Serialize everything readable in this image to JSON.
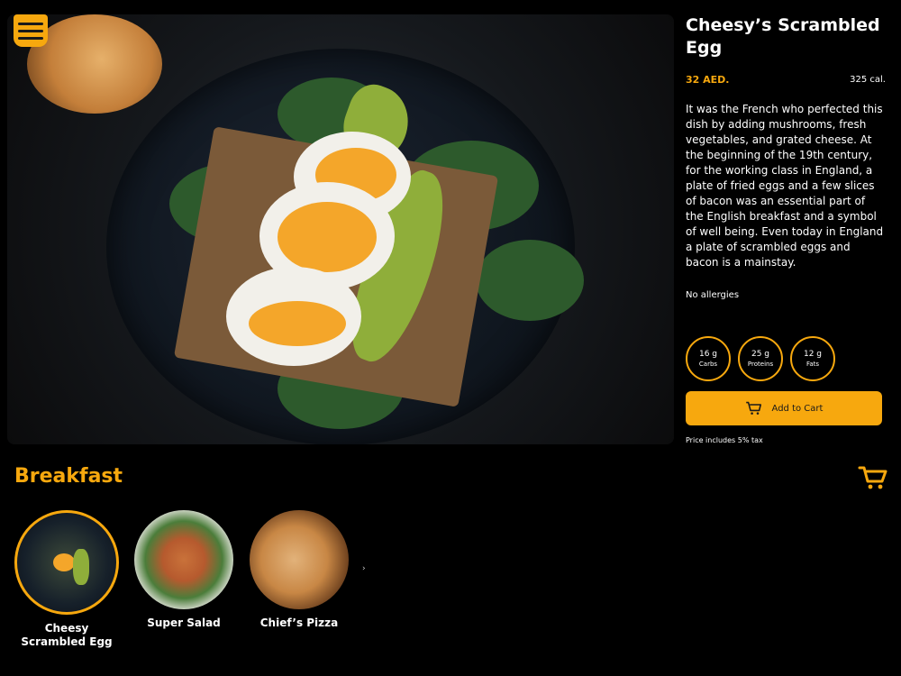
{
  "product": {
    "title": "Cheesy’s Scrambled Egg",
    "price": "32 AED.",
    "calories": "325 cal.",
    "description": "It was the French who perfected this dish by adding mushrooms, fresh vegetables, and grated cheese. At the beginning of the 19th century, for the working class in England, a plate of fried eggs and a few slices of bacon was an essential part of the English breakfast and a symbol of well being. Even today in England a plate of scrambled eggs and bacon is a mainstay.",
    "allergies": "No allergies",
    "macros": [
      {
        "value": "16 g",
        "label": "Carbs"
      },
      {
        "value": "25 g",
        "label": "Proteins"
      },
      {
        "value": "12 g",
        "label": "Fats"
      }
    ],
    "add_to_cart_label": "Add to Cart",
    "tax_note": "Price includes 5% tax"
  },
  "category": {
    "title": "Breakfast",
    "items": [
      {
        "name": "Cheesy Scrambled Egg",
        "active": true
      },
      {
        "name": "Super Salad",
        "active": false
      },
      {
        "name": "Chief’s Pizza",
        "active": false
      }
    ],
    "next_glyph": "›"
  },
  "colors": {
    "accent": "#f7a80e",
    "background": "#000000"
  },
  "icons": [
    "menu-icon",
    "cart-icon"
  ]
}
